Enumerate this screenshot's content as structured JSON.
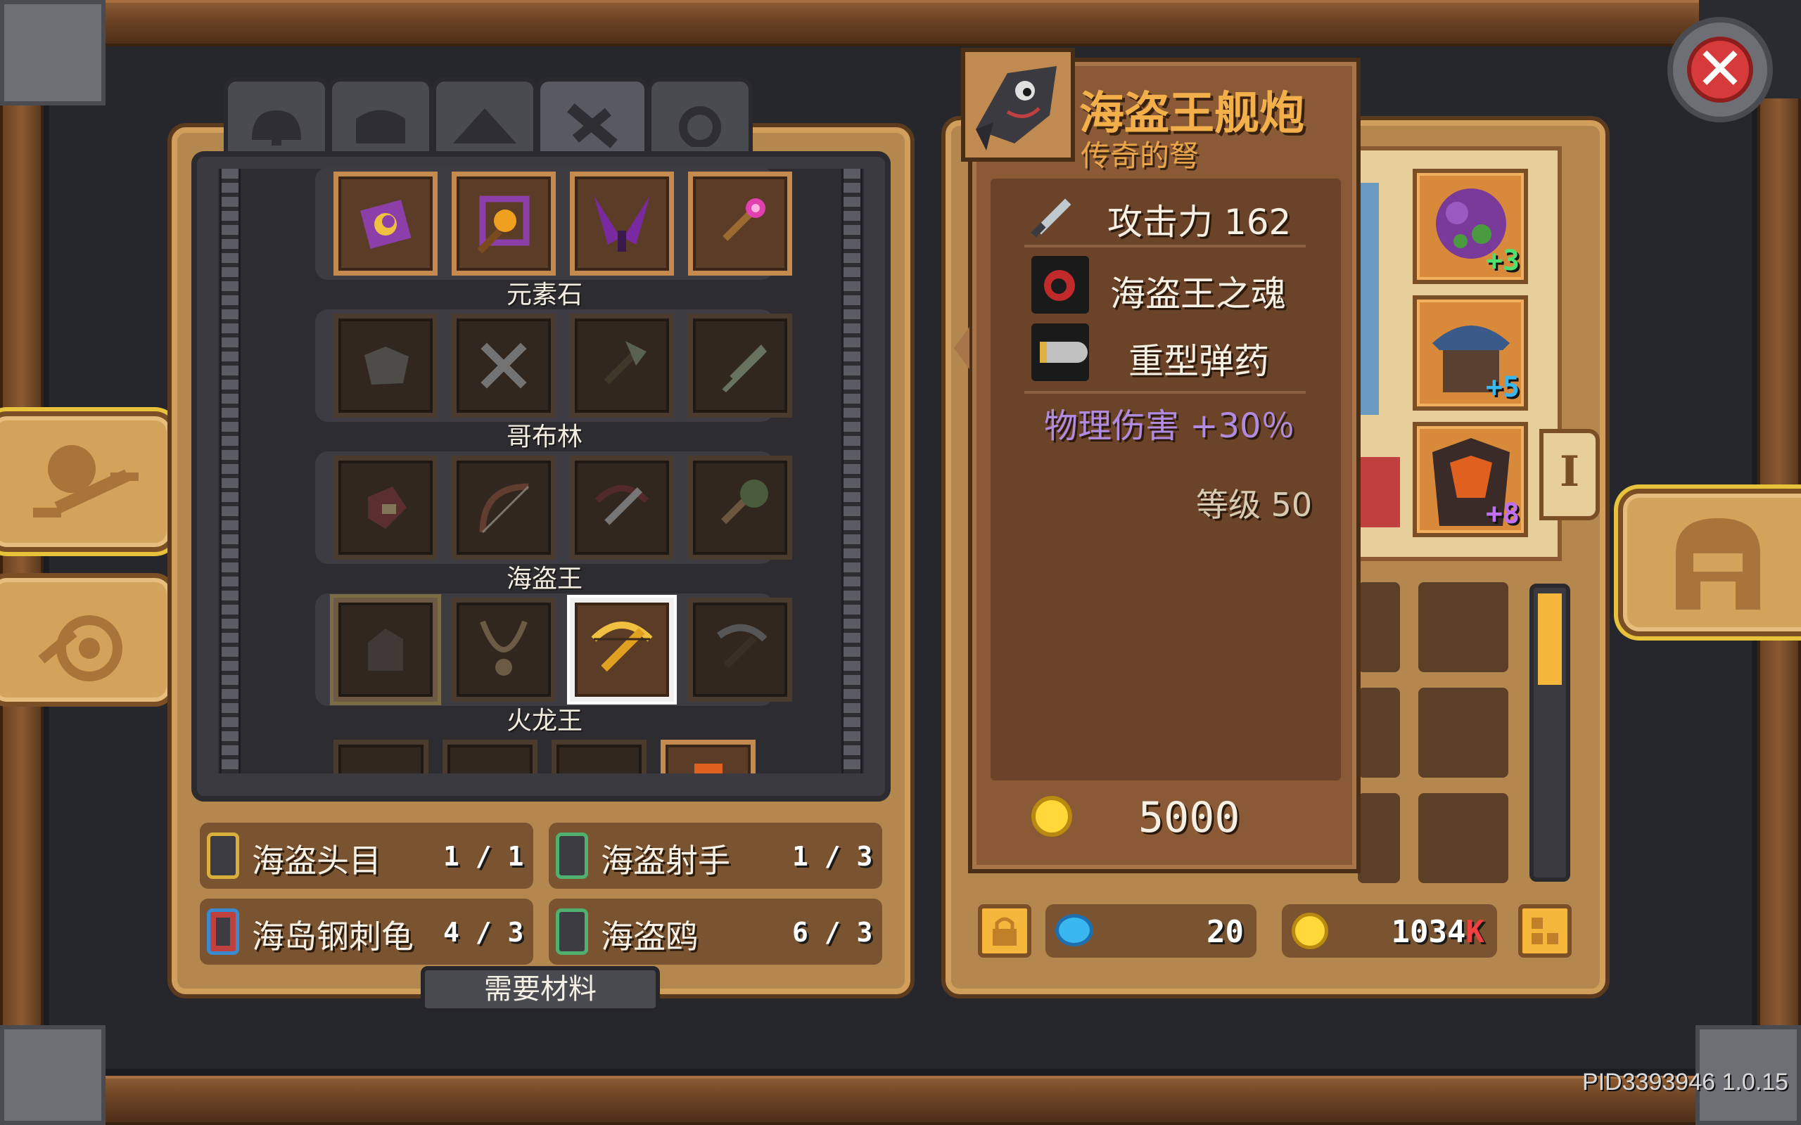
{
  "colors": {
    "accent_gold": "#f4b73c",
    "title_orange": "#f3b04a",
    "rarity_text": "#e8a54a",
    "purple_stat": "#b18be0",
    "close_red": "#d63a3a"
  },
  "left_panel": {
    "tabs": [
      "helmet-icon",
      "chest-armor-icon",
      "cloak-icon",
      "sword-icon",
      "ring-icon"
    ],
    "rows": [
      {
        "label": "元素石",
        "items": [
          "spellbook-icon",
          "staff-frame-icon",
          "wing-bow-icon",
          "scepter-icon"
        ]
      },
      {
        "label": "哥布林",
        "items": [
          "leather-armor-icon",
          "crossed-blades-icon",
          "axe-icon",
          "leaf-sword-icon"
        ]
      },
      {
        "label": "海盗王",
        "items": [
          "red-glove-icon",
          "pirate-bow-icon",
          "crossbow-icon",
          "mace-icon"
        ]
      },
      {
        "label": "火龙王",
        "items": [
          "gauntlet-icon",
          "necklace-icon",
          "golden-crossbow-icon",
          "pickaxe-icon"
        ]
      }
    ],
    "materials": [
      {
        "name": "海盗头目",
        "count": "1 / 1",
        "color": "#d9b03a"
      },
      {
        "name": "海盗射手",
        "count": "1 / 3",
        "color": "#4fb070"
      },
      {
        "name": "海岛钢刺龟",
        "count": "4 / 3",
        "color": "#3a8ad0"
      },
      {
        "name": "海盗鸥",
        "count": "6 / 3",
        "color": "#4fb070"
      }
    ],
    "need_materials_label": "需要材料"
  },
  "tooltip": {
    "name": "海盗王舰炮",
    "rarity": "传奇的弩",
    "attack_label": "攻击力 162",
    "soul": "海盗王之魂",
    "ammo": "重型弹药",
    "bonus": "物理伤害 +30％",
    "level": "等级 50",
    "price": "5000"
  },
  "right_panel": {
    "equipped": [
      {
        "icon": "purple-gem-icon",
        "plus": "+3",
        "plus_color": "#4fe070"
      },
      {
        "icon": "blue-helmet-icon",
        "plus": "+5",
        "plus_color": "#3ab6f0"
      },
      {
        "icon": "lava-armor-icon",
        "plus": "+8",
        "plus_color": "#c070f0"
      }
    ],
    "roman_tab": "I",
    "gems": "20",
    "gold": "1034",
    "gold_suffix": "K"
  },
  "version": "PID3393946 1.0.15"
}
